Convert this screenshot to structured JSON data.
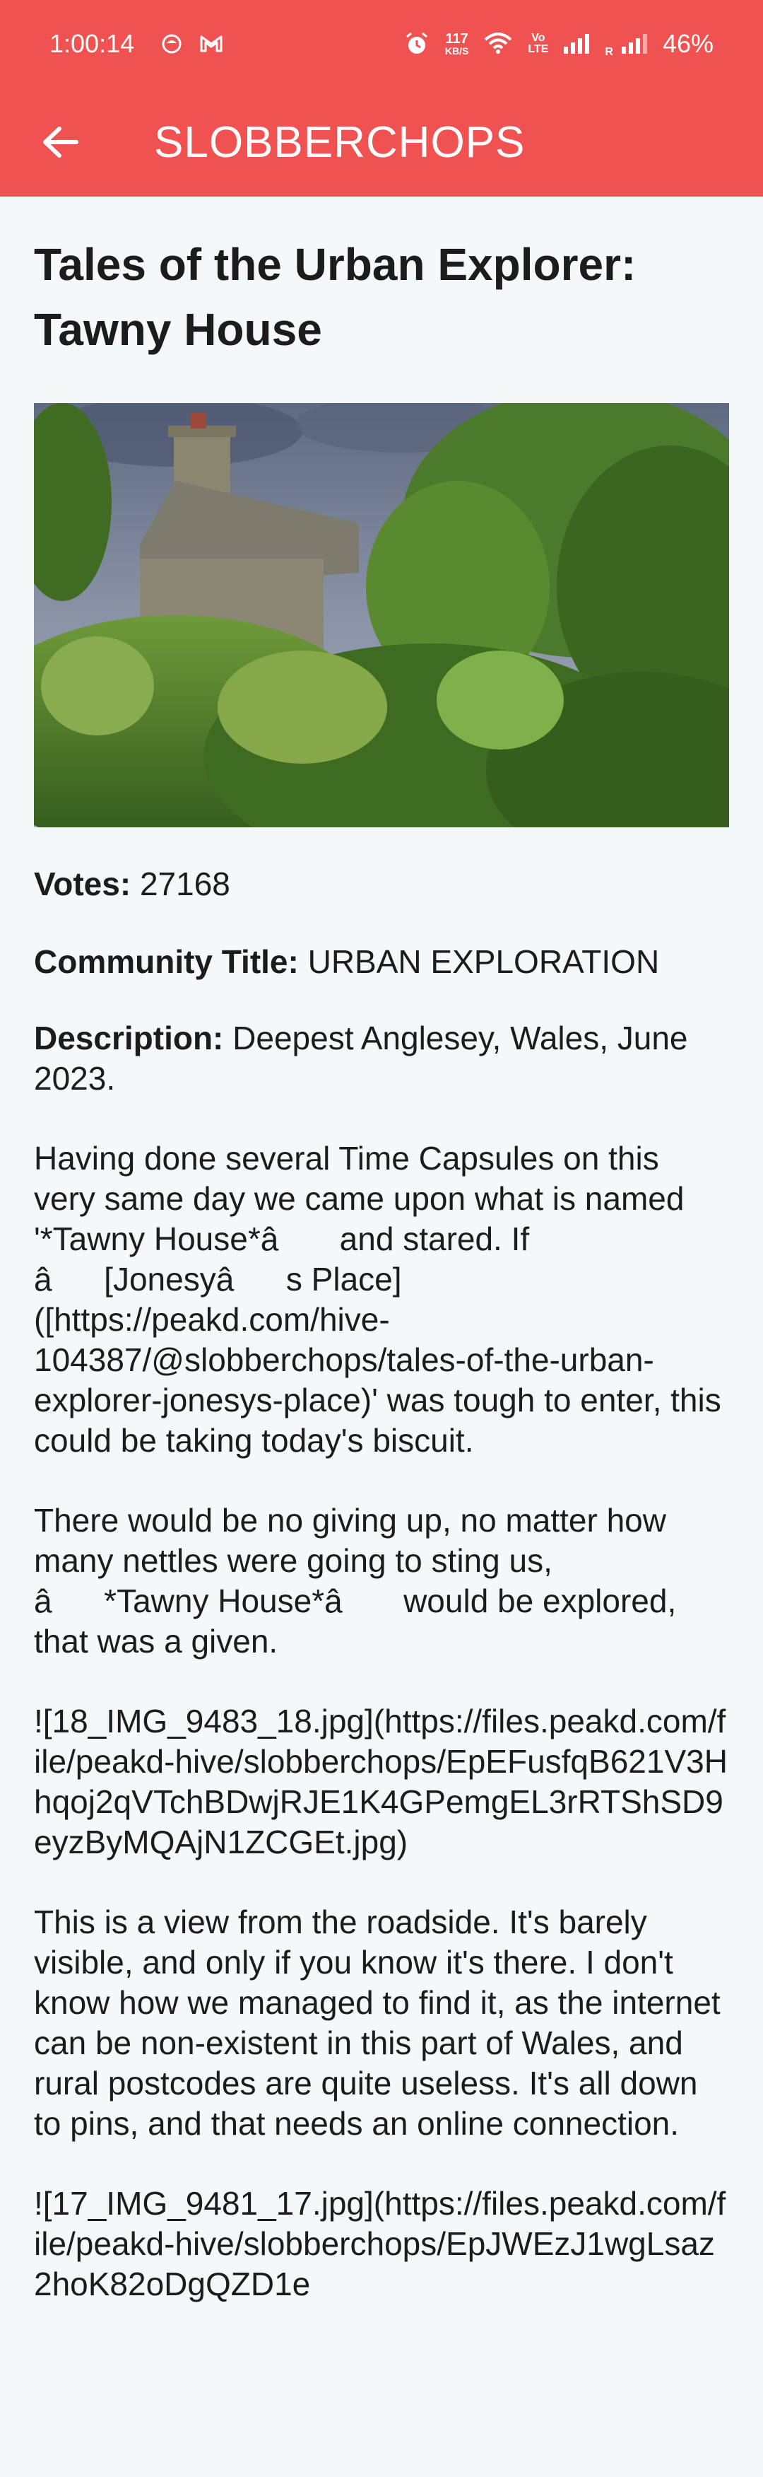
{
  "status_bar": {
    "time": "1:00:14",
    "speed_value": "117",
    "speed_unit": "KB/S",
    "volte_top": "Vo",
    "volte_bottom": "LTE",
    "roaming": "R",
    "battery": "46%"
  },
  "app_bar": {
    "title": "SLOBBERCHOPS"
  },
  "post": {
    "title": "Tales of the Urban Explorer: Tawny House",
    "votes_label": "Votes:",
    "votes_value": "27168",
    "community_label": "Community Title:",
    "community_value": "URBAN EXPLORATION",
    "description_label": "Description:",
    "description_value": "Deepest Anglesey, Wales, June 2023.",
    "paragraphs": [
      "Having done several Time Capsules on this very same day we came upon what is named '*Tawny House*â and stared. If â[Jonesyâs Place]([https://peakd.com/hive-104387/@slobberchops/tales-of-the-urban-explorer-jonesys-place)' was tough to enter, this could be taking today's biscuit.",
      "There would be no giving up, no matter how many nettles were going to sting us, â*Tawny House*â would be explored, that was a given.",
      "![18_IMG_9483_18.jpg](https://files.peakd.com/file/peakd-hive/slobberchops/EpEFusfqB621V3Hhqoj2qVTchBDwjRJE1K4GPemgEL3rRTShSD9eyzByMQAjN1ZCGEt.jpg)",
      "This is a view from the roadside. It's barely visible, and only if you know it's there. I don't know how we managed to find it, as the internet can be non-existent in this part of Wales, and rural postcodes are quite useless. It's all down to pins, and that needs an online connection.",
      "![17_IMG_9481_17.jpg](https://files.peakd.com/file/peakd-hive/slobberchops/EpJWEzJ1wgLsaz2hoK82oDgQZD1e"
    ]
  },
  "icons": {
    "back": "arrow-left-icon",
    "alarm": "alarm-icon",
    "wifi": "wifi-icon",
    "gmail": "gmail-icon",
    "app": "app-notification-icon"
  },
  "colors": {
    "app_bar": "#f05252",
    "background": "#f4f8f8"
  }
}
